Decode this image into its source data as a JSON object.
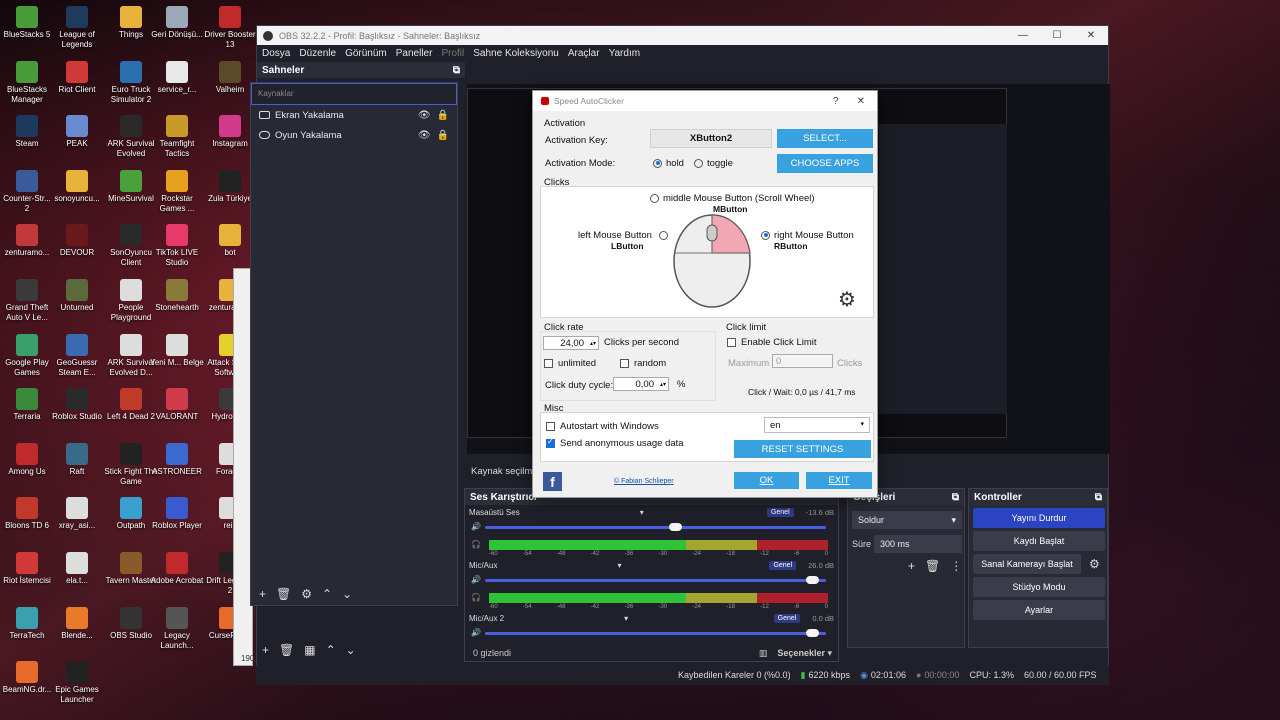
{
  "desktop": {
    "icons": [
      {
        "label": "BlueStacks 5",
        "color": "#4a9c3a"
      },
      {
        "label": "League of Legends",
        "color": "#1e3a5c"
      },
      {
        "label": "Things",
        "color": "#e8b33a"
      },
      {
        "label": "Geri Dönüşü...",
        "color": "#9aa8b8"
      },
      {
        "label": "Driver Booster 13",
        "color": "#c02a2a"
      },
      {
        "label": "BlueStacks Manager",
        "color": "#4a9c3a"
      },
      {
        "label": "Riot Client",
        "color": "#d13838"
      },
      {
        "label": "Euro Truck Simulator 2",
        "color": "#2a6fb0"
      },
      {
        "label": "service_r...",
        "color": "#e8e8e8"
      },
      {
        "label": "Valheim",
        "color": "#5b4a2a"
      },
      {
        "label": "Steam",
        "color": "#1b3a5e"
      },
      {
        "label": "PEAK",
        "color": "#6a8ad0"
      },
      {
        "label": "ARK Survival Evolved",
        "color": "#2a2a2a"
      },
      {
        "label": "Teamfight Tactics",
        "color": "#c89a2a"
      },
      {
        "label": "Instagram",
        "color": "#d43a8a"
      },
      {
        "label": "Counter-Str... 2",
        "color": "#3a5a9a"
      },
      {
        "label": "sonoyuncu...",
        "color": "#e8b33a"
      },
      {
        "label": "MineSurvival",
        "color": "#4aa03a"
      },
      {
        "label": "Rockstar Games ...",
        "color": "#e8a020"
      },
      {
        "label": "Zula Türkiye",
        "color": "#222"
      },
      {
        "label": "zenturamo...",
        "color": "#c03a3a"
      },
      {
        "label": "DEVOUR",
        "color": "#6a1a1a"
      },
      {
        "label": "SonOyuncu Client",
        "color": "#2a2a2a"
      },
      {
        "label": "TikTok LIVE Studio",
        "color": "#e83a6a"
      },
      {
        "label": "bot",
        "color": "#e8b33a"
      },
      {
        "label": "Grand Theft Auto V Le...",
        "color": "#3a3a3a"
      },
      {
        "label": "Unturned",
        "color": "#5a6a3a"
      },
      {
        "label": "People Playground",
        "color": "#ddd"
      },
      {
        "label": "Stonehearth",
        "color": "#8a7a3a"
      },
      {
        "label": "zenturamod",
        "color": "#e8b33a"
      },
      {
        "label": "Google Play Games",
        "color": "#3aa06a"
      },
      {
        "label": "GeoGuessr Steam E...",
        "color": "#3a6ab0"
      },
      {
        "label": "ARK Survival Evolved D...",
        "color": "#ddd"
      },
      {
        "label": "Yeni M... Belge",
        "color": "#ddd"
      },
      {
        "label": "Attack Shark Software",
        "color": "#e8d02a"
      },
      {
        "label": "Terraria",
        "color": "#3a8a3a"
      },
      {
        "label": "Roblox Studio",
        "color": "#2a2a2a"
      },
      {
        "label": "Left 4 Dead 2",
        "color": "#c03a2a"
      },
      {
        "label": "VALORANT",
        "color": "#d03a4a"
      },
      {
        "label": "Hydroneer",
        "color": "#3a3a3a"
      },
      {
        "label": "Among Us",
        "color": "#c02a2a"
      },
      {
        "label": "Raft",
        "color": "#3a6a8a"
      },
      {
        "label": "Stick Fight The Game",
        "color": "#222"
      },
      {
        "label": "ASTRONEER",
        "color": "#3a6ad0"
      },
      {
        "label": "Forager",
        "color": "#ddd"
      },
      {
        "label": "Bloons TD 6",
        "color": "#c03a2a"
      },
      {
        "label": "xray_asi...",
        "color": "#ddd"
      },
      {
        "label": "Outpath",
        "color": "#3aa0d0"
      },
      {
        "label": "Roblox Player",
        "color": "#3a5ad0"
      },
      {
        "label": "reis",
        "color": "#ddd"
      },
      {
        "label": "Riot İstemcisi",
        "color": "#d13838"
      },
      {
        "label": "ela.t...",
        "color": "#ddd"
      },
      {
        "label": "Tavern Master",
        "color": "#8a5a2a"
      },
      {
        "label": "Adobe Acrobat",
        "color": "#c02a2a"
      },
      {
        "label": "Drift Legends 2",
        "color": "#222"
      },
      {
        "label": "TerraTech",
        "color": "#3aa0b0"
      },
      {
        "label": "Blende...",
        "color": "#e87a2a"
      },
      {
        "label": "OBS Studio",
        "color": "#333"
      },
      {
        "label": "Legacy Launch...",
        "color": "#555"
      },
      {
        "label": "CurseForge",
        "color": "#e86a2a"
      },
      {
        "label": "BeamNG.dr...",
        "color": "#e86a2a"
      },
      {
        "label": "Epic Games Launcher",
        "color": "#222"
      }
    ]
  },
  "obs": {
    "title": "OBS 32.2.2 - Profil: Başlıksız - Sahneler: Başlıksız",
    "menu": [
      "Dosya",
      "Düzenle",
      "Görünüm",
      "Paneller",
      "Profil",
      "Sahne Koleksiyonu",
      "Araçlar",
      "Yardım"
    ],
    "scenes_title": "Sahneler",
    "sources_placeholder": "Kaynaklar",
    "sources": [
      "Ekran Yakalama",
      "Oyun Yakalama"
    ],
    "source_select_label": "Kaynak seçilme",
    "mixer_title": "Ses Karıştırıcı",
    "tracks": [
      {
        "name": "Masaüstü Ses",
        "tag": "Genel",
        "db": "-13.6 dB",
        "level": 0.57
      },
      {
        "name": "Mic/Aux",
        "tag": "Genel",
        "db": "26.0 dB",
        "level": 0.97
      },
      {
        "name": "Mic/Aux 2",
        "tag": "Genel",
        "db": "0.0 dB",
        "level": 0.97
      }
    ],
    "meter_ticks": [
      "-60",
      "-54",
      "-48",
      "-42",
      "-36",
      "-30",
      "-24",
      "-18",
      "-12",
      "-6",
      "0"
    ],
    "hidden_count": "0 gizlendi",
    "options_label": "Seçenekler",
    "transitions_title": "Geçişleri",
    "transition_value": "Soldur",
    "duration_label": "Süre",
    "duration_value": "300 ms",
    "controls_title": "Kontroller",
    "controls": [
      "Yayını Durdur",
      "Kaydı Başlat",
      "Sanal Kamerayı Başlat",
      "Stüdyo Modu",
      "Ayarlar"
    ],
    "status": {
      "dropped": "Kaybedilen Kareler 0 (%0.0)",
      "bitrate": "6220 kbps",
      "stream_time": "02:01:06",
      "rec_time": "00:00:00",
      "cpu": "CPU: 1.3%",
      "fps": "60.00 / 60.00 FPS"
    },
    "side_labels": {
      "a": "190"
    }
  },
  "ac": {
    "title": "Speed AutoClicker",
    "help": "?",
    "close": "✕",
    "activation_hdr": "Activation",
    "activation_key_label": "Activation Key:",
    "activation_key": "XButton2",
    "select_btn": "SELECT...",
    "activation_mode_label": "Activation Mode:",
    "mode_hold": "hold",
    "mode_toggle": "toggle",
    "choose_apps": "CHOOSE APPS",
    "clicks_hdr": "Clicks",
    "middle_label": "middle Mouse Button (Scroll Wheel)",
    "middle_sub": "MButton",
    "left_label": "left Mouse Button",
    "left_sub": "LButton",
    "right_label": "right Mouse Button",
    "right_sub": "RButton",
    "click_rate_hdr": "Click rate",
    "rate_value": "24,00",
    "rate_unit": "Clicks per second",
    "unlimited": "unlimited",
    "random": "random",
    "duty_label": "Click duty cycle:",
    "duty_value": "0,00",
    "duty_unit": "%",
    "click_limit_hdr": "Click limit",
    "enable_limit": "Enable Click Limit",
    "maximum_label": "Maximum",
    "maximum_value": "0",
    "clicks_unit": "Clicks",
    "wait_text": "Click / Wait: 0,0 µs / 41,7 ms",
    "misc_hdr": "Misc",
    "autostart": "Autostart with Windows",
    "send_usage": "Send anonymous usage data",
    "language": "en",
    "reset": "RESET SETTINGS",
    "fb": "f",
    "author": "© Fabian Schlieper",
    "ok": "OK",
    "exit": "EXIT"
  }
}
